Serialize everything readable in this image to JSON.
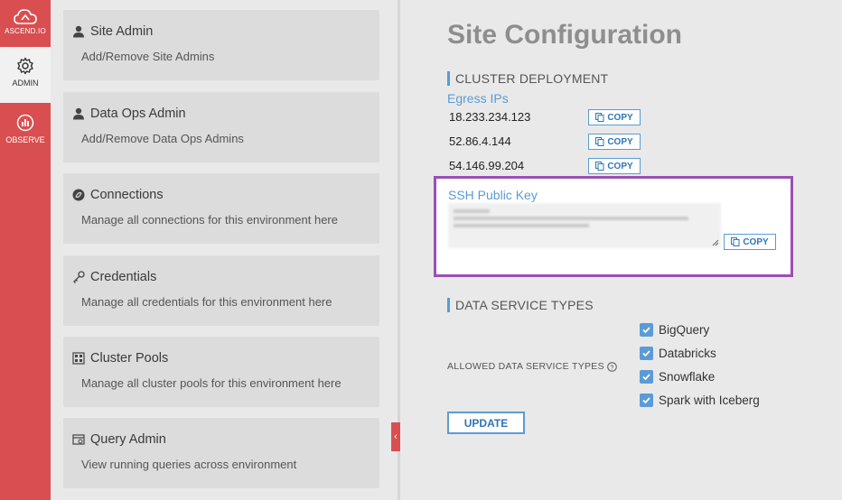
{
  "rail": {
    "logo_label": "ASCEND.IO",
    "admin_label": "ADMIN",
    "observe_label": "OBSERVE"
  },
  "cards": [
    {
      "title": "Site Admin",
      "desc": "Add/Remove Site Admins",
      "icon": "user-icon"
    },
    {
      "title": "Data Ops Admin",
      "desc": "Add/Remove Data Ops Admins",
      "icon": "user-icon"
    },
    {
      "title": "Connections",
      "desc": "Manage all connections for this environment here",
      "icon": "connections-icon"
    },
    {
      "title": "Credentials",
      "desc": "Manage all credentials for this environment here",
      "icon": "key-icon"
    },
    {
      "title": "Cluster Pools",
      "desc": "Manage all cluster pools for this environment here",
      "icon": "cluster-icon"
    },
    {
      "title": "Query Admin",
      "desc": "View running queries across environment",
      "icon": "query-icon"
    }
  ],
  "main": {
    "page_title": "Site Configuration",
    "cluster_section": "CLUSTER DEPLOYMENT",
    "egress_label": "Egress IPs",
    "ips": [
      "18.233.234.123",
      "52.86.4.144",
      "54.146.99.204"
    ],
    "copy_label": "COPY",
    "ssh_label": "SSH Public Key",
    "data_service_section": "DATA SERVICE TYPES",
    "allowed_label": "ALLOWED DATA SERVICE TYPES",
    "service_types": [
      {
        "label": "BigQuery",
        "checked": true
      },
      {
        "label": "Databricks",
        "checked": true
      },
      {
        "label": "Snowflake",
        "checked": true
      },
      {
        "label": "Spark with Iceberg",
        "checked": true
      }
    ],
    "update_label": "UPDATE"
  },
  "colors": {
    "rail": "#d94e50",
    "accent": "#5b9bd5",
    "highlight": "#9b4fb5"
  }
}
